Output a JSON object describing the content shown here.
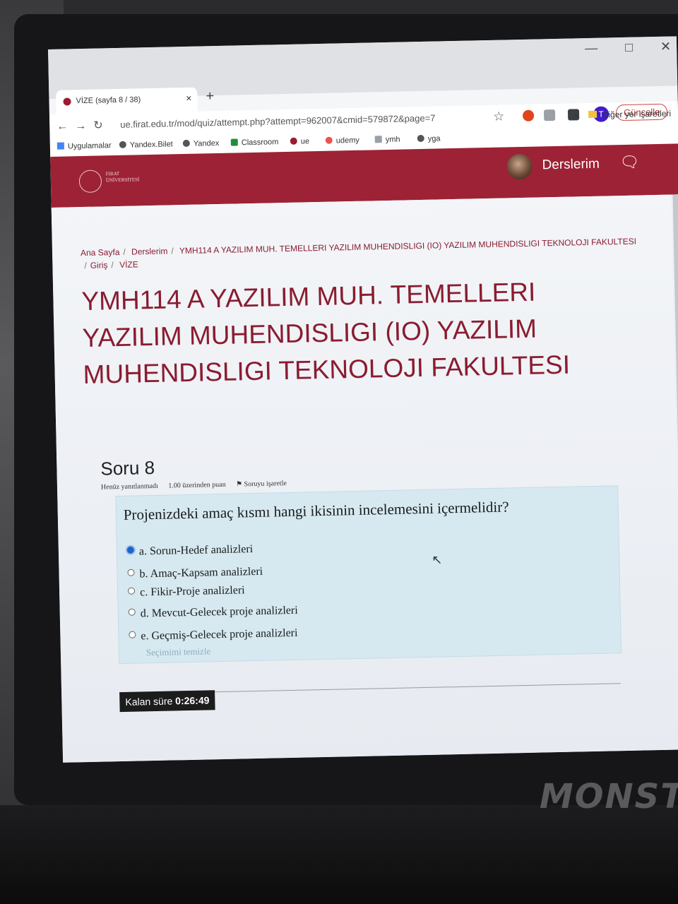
{
  "browser": {
    "tab_title": "VİZE (sayfa 8 / 38)",
    "tab_close": "×",
    "new_tab": "+",
    "url": "ue.firat.edu.tr/mod/quiz/attempt.php?attempt=962007&cmid=579872&page=7",
    "profile_initial": "T",
    "update_label": "Güncelle",
    "more_bookmarks": "»",
    "other_bookmarks": "Diğer yer işaretleri",
    "bookmarks": [
      "Uygulamalar",
      "Yandex.Bilet",
      "Yandex",
      "Classroom",
      "ue",
      "udemy",
      "ymh",
      "yga"
    ]
  },
  "site": {
    "logo_text": "FIRAT ÜNİVERSİTESİ",
    "courses_label": "Derslerim"
  },
  "breadcrumb": {
    "home": "Ana Sayfa",
    "courses": "Derslerim",
    "course": "YMH114 A YAZILIM MUH. TEMELLERI YAZILIM MUHENDISLIGI (IO) YAZILIM MUHENDISLIGI TEKNOLOJI FAKULTESI",
    "section": "Giriş",
    "quiz": "VİZE"
  },
  "course_title": "YMH114 A YAZILIM MUH. TEMELLERI YAZILIM MUHENDISLIGI (IO) YAZILIM MUHENDISLIGI TEKNOLOJI FAKULTESI",
  "question": {
    "number": "Soru 8",
    "status": "Henüz yanıtlanmadı",
    "points": "1.00 üzerinden puan",
    "flag": "Soruyu işaretle",
    "text": "Projenizdeki amaç kısmı hangi ikisinin incelemesini içermelidir?",
    "options": [
      {
        "label": "a. Sorun-Hedef analizleri",
        "selected": true
      },
      {
        "label": "b. Amaç-Kapsam analizleri",
        "selected": false
      },
      {
        "label": "c. Fikir-Proje analizleri",
        "selected": false
      },
      {
        "label": "d. Mevcut-Gelecek proje analizleri",
        "selected": false
      },
      {
        "label": "e. Geçmiş-Gelecek proje analizleri",
        "selected": false
      }
    ],
    "clear_choice": "Seçimimi temizle"
  },
  "timer": {
    "label": "Kalan süre",
    "value": "0:26:49"
  },
  "device_brand": "MONST"
}
